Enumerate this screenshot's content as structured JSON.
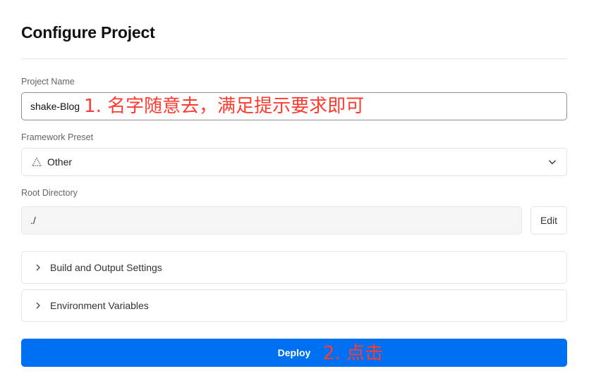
{
  "page": {
    "title": "Configure Project"
  },
  "project_name": {
    "label": "Project Name",
    "value": "shake-Blog",
    "annotation": "1. 名字随意去，满足提示要求即可"
  },
  "framework_preset": {
    "label": "Framework Preset",
    "selected": "Other",
    "icon": "triangle-icon"
  },
  "root_directory": {
    "label": "Root Directory",
    "value": "./",
    "edit_label": "Edit"
  },
  "sections": [
    {
      "label": "Build and Output Settings",
      "icon": "chevron-right-icon"
    },
    {
      "label": "Environment Variables",
      "icon": "chevron-right-icon"
    }
  ],
  "deploy": {
    "label": "Deploy",
    "annotation": "2. 点击"
  },
  "colors": {
    "accent": "#0070f3",
    "annotation": "#ff3b30"
  }
}
